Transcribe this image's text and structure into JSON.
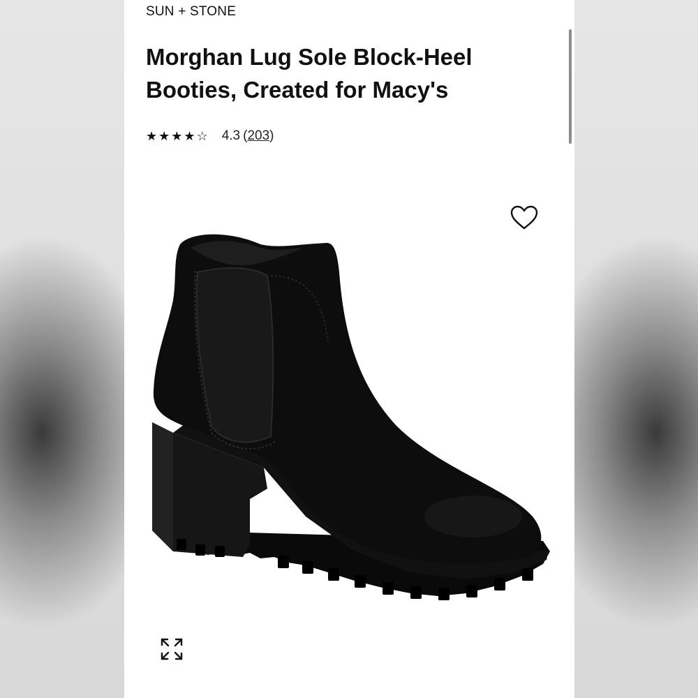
{
  "product": {
    "brand": "SUN + STONE",
    "title": "Morghan Lug Sole Block-Heel Booties, Created for Macy's",
    "rating": {
      "stars_display": [
        "★",
        "★",
        "★",
        "★",
        "☆"
      ],
      "value": "4.3",
      "count": "203"
    },
    "image": {
      "description_icon": "boot-image",
      "color": "#0d0d0d"
    }
  },
  "controls": {
    "wishlist_icon": "heart-outline-icon",
    "expand_icon": "expand-arrows-icon"
  }
}
